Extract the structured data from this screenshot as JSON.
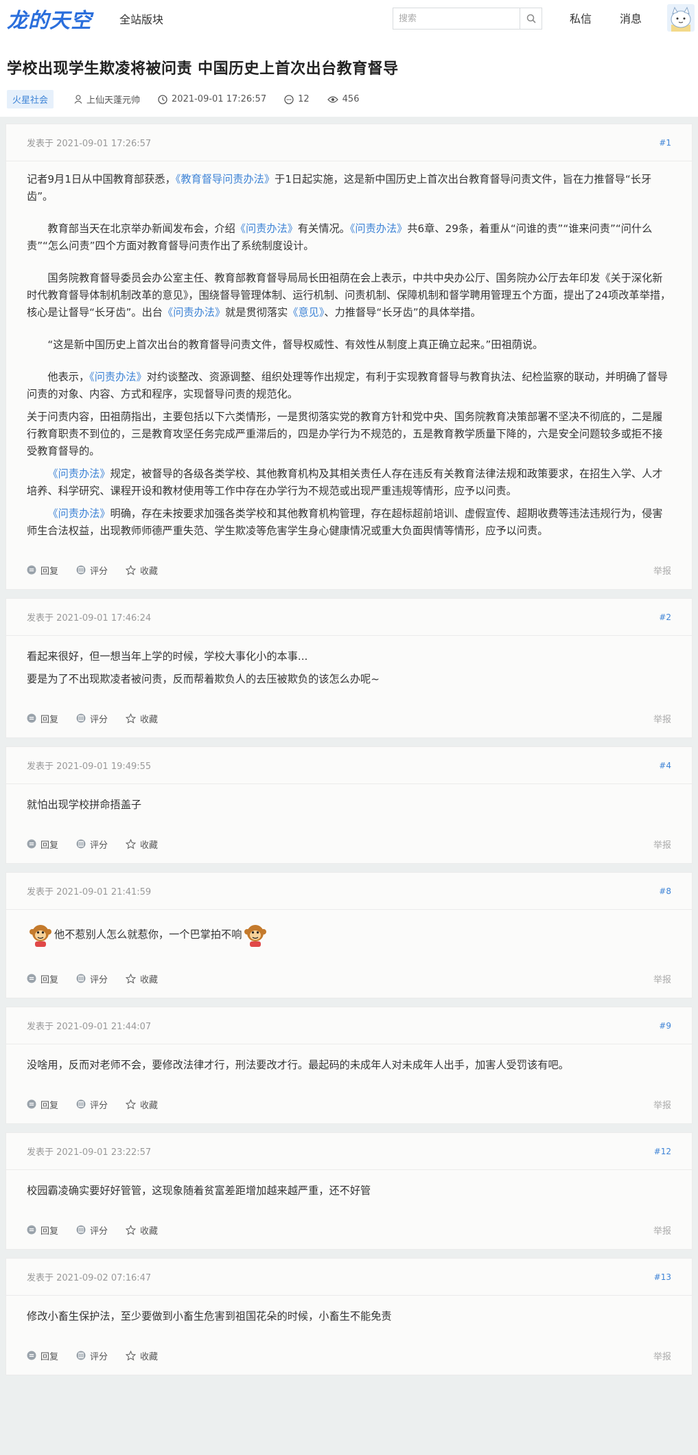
{
  "header": {
    "logo": "龙的天空",
    "nav_all": "全站版块",
    "search_placeholder": "搜索",
    "private_msg": "私信",
    "messages": "消息"
  },
  "thread": {
    "title": "学校出现学生欺凌将被问责 中国历史上首次出台教育督导",
    "tag": "火星社会",
    "author": "上仙天蓬元帅",
    "datetime": "2021-09-01 17:26:57",
    "reply_count": "12",
    "view_count": "456"
  },
  "actions": {
    "reply": "回复",
    "rate": "评分",
    "favorite": "收藏",
    "report": "举报"
  },
  "posts": [
    {
      "posted": "发表于 2021-09-01 17:26:57",
      "floor": "#1",
      "p1a": "记者9月1日从中国教育部获悉，",
      "p1link": "《教育督导问责办法》",
      "p1b": "于1日起实施，这是新中国历史上首次出台教育督导问责文件，旨在力推督导“长牙齿”。",
      "p2a": "教育部当天在北京举办新闻发布会，介绍",
      "p2link1": "《问责办法》",
      "p2b": "有关情况。",
      "p2link2": "《问责办法》",
      "p2c": "共6章、29条，着重从“问谁的责”“谁来问责”“问什么责”“怎么问责”四个方面对教育督导问责作出了系统制度设计。",
      "p3a": "国务院教育督导委员会办公室主任、教育部教育督导局局长田祖荫在会上表示，中共中央办公厅、国务院办公厅去年印发《关于深化新时代教育督导体制机制改革的意见》，围绕督导管理体制、运行机制、问责机制、保障机制和督学聘用管理五个方面，提出了24项改革举措，核心是让督导“长牙齿”。出台",
      "p3link1": "《问责办法》",
      "p3b": "就是贯彻落实",
      "p3link2": "《意见》",
      "p3c": "、力推督导“长牙齿”的具体举措。",
      "p4": "“这是新中国历史上首次出台的教育督导问责文件，督导权威性、有效性从制度上真正确立起来。”田祖荫说。",
      "p5a": "他表示，",
      "p5link": "《问责办法》",
      "p5b": "对约谈整改、资源调整、组织处理等作出规定，有利于实现教育督导与教育执法、纪检监察的联动，并明确了督导问责的对象、内容、方式和程序，实现督导问责的规范化。",
      "p6": "关于问责内容，田祖荫指出，主要包括以下六类情形，一是贯彻落实党的教育方针和党中央、国务院教育决策部署不坚决不彻底的，二是履行教育职责不到位的，三是教育攻坚任务完成严重滞后的，四是办学行为不规范的，五是教育教学质量下降的，六是安全问题较多或拒不接受教育督导的。",
      "p7link": "《问责办法》",
      "p7b": "规定，被督导的各级各类学校、其他教育机构及其相关责任人存在违反有关教育法律法规和政策要求，在招生入学、人才培养、科学研究、课程开设和教材使用等工作中存在办学行为不规范或出现严重违规等情形，应予以问责。",
      "p8link": "《问责办法》",
      "p8b": "明确，存在未按要求加强各类学校和其他教育机构管理，存在超标超前培训、虚假宣传、超期收费等违法违规行为，侵害师生合法权益，出现教师师德严重失范、学生欺凌等危害学生身心健康情况或重大负面舆情等情形，应予以问责。"
    },
    {
      "posted": "发表于 2021-09-01 17:46:24",
      "floor": "#2",
      "line1": "看起来很好，但一想当年上学的时候，学校大事化小的本事...",
      "line2": "要是为了不出现欺凌者被问责，反而帮着欺负人的去压被欺负的该怎么办呢~"
    },
    {
      "posted": "发表于 2021-09-01 19:49:55",
      "floor": "#4",
      "line1": "就怕出现学校拼命捂盖子"
    },
    {
      "posted": "发表于 2021-09-01 21:41:59",
      "floor": "#8",
      "line1": "他不惹别人怎么就惹你，一个巴掌拍不响"
    },
    {
      "posted": "发表于 2021-09-01 21:44:07",
      "floor": "#9",
      "line1": "没啥用，反而对老师不会，要修改法律才行，刑法要改才行。最起码的未成年人对未成年人出手，加害人受罚该有吧。"
    },
    {
      "posted": "发表于 2021-09-01 23:22:57",
      "floor": "#12",
      "line1": "校园霸凌确实要好好管管，这现象随着贫富差距增加越来越严重，还不好管"
    },
    {
      "posted": "发表于 2021-09-02 07:16:47",
      "floor": "#13",
      "line1": "修改小畜生保护法，至少要做到小畜生危害到祖国花朵的时候，小畜生不能免责"
    }
  ]
}
